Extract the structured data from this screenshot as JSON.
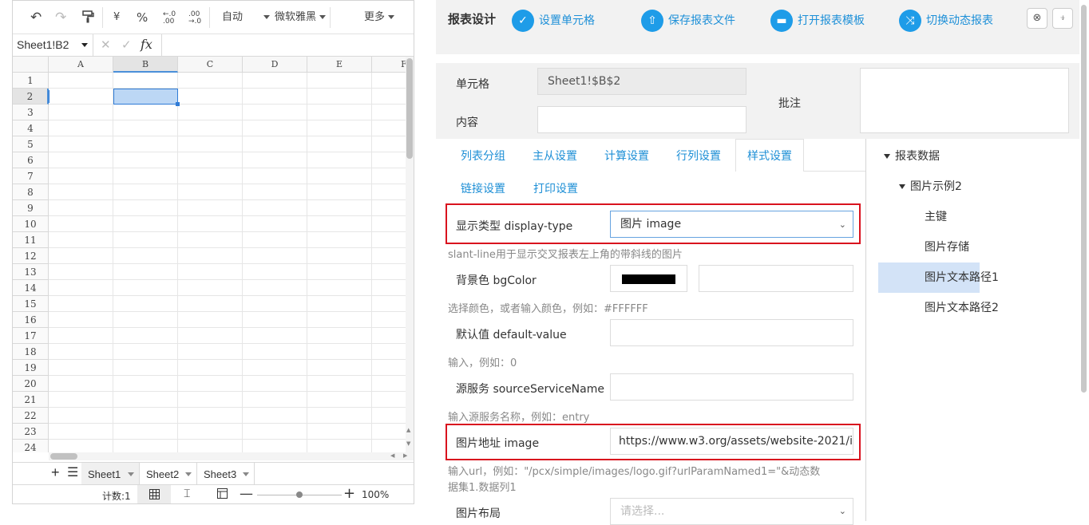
{
  "spreadsheet": {
    "toolbar": {
      "undo_icon": "undo-icon",
      "redo_icon": "redo-icon",
      "format_painter_icon": "format-painter-icon",
      "currency": "¥",
      "percent": "%",
      "dec_increase": ".0 .00",
      "dec_decrease": ".00 .0",
      "number_format": "自动",
      "font_name": "微软雅黑",
      "more": "更多"
    },
    "namebox": "Sheet1!B2",
    "formula_cancel": "✕",
    "formula_confirm": "✓",
    "formula_fx": "fx",
    "formula_value": "",
    "columns": [
      "A",
      "B",
      "C",
      "D",
      "E",
      "F"
    ],
    "rows": [
      "1",
      "2",
      "3",
      "4",
      "5",
      "6",
      "7",
      "8",
      "9",
      "10",
      "11",
      "12",
      "13",
      "14",
      "15",
      "16",
      "17",
      "18",
      "19",
      "20",
      "21",
      "22",
      "23",
      "24"
    ],
    "selected_cell": "B2",
    "sheets": [
      "Sheet1",
      "Sheet2",
      "Sheet3"
    ],
    "active_sheet": "Sheet1",
    "status": {
      "count_label": "计数:1",
      "zoom": "100%",
      "zoom_slider_value": 0.5
    }
  },
  "designer": {
    "title": "报表设计",
    "actions": [
      {
        "label": "设置单元格",
        "icon": "check-icon"
      },
      {
        "label": "保存报表文件",
        "icon": "upload-icon"
      },
      {
        "label": "打开报表模板",
        "icon": "folder-icon"
      },
      {
        "label": "切换动态报表",
        "icon": "shuffle-icon"
      }
    ],
    "close_icon": "close-circle-icon",
    "pin_icon": "pin-icon",
    "cell_label": "单元格",
    "cell_value": "Sheet1!$B$2",
    "content_label": "内容",
    "content_value": "",
    "comment_label": "批注",
    "comment_value": "",
    "tabs": [
      "列表分组",
      "主从设置",
      "计算设置",
      "行列设置",
      "样式设置",
      "链接设置",
      "打印设置"
    ],
    "active_tab": "样式设置",
    "fields": {
      "display_type_label": "显示类型 display-type",
      "display_type_value": "图片 image",
      "display_type_hint": "slant-line用于显示交叉报表左上角的带斜线的图片",
      "bgcolor_label": "背景色 bgColor",
      "bgcolor_swatch": "#000000",
      "bgcolor_text": "",
      "bgcolor_hint": "选择颜色，或者输入颜色，例如：#FFFFFF",
      "default_label": "默认值 default-value",
      "default_value": "",
      "default_hint": "输入，例如：0",
      "source_label": "源服务 sourceServiceName",
      "source_value": "",
      "source_hint": "输入源服务名称，例如：entry",
      "image_label": "图片地址 image",
      "image_value": "https://www.w3.org/assets/website-2021/i",
      "image_hint_line1": "输入url，例如：\"/pcx/simple/images/logo.gif?urlParamNamed1=\"&动态数",
      "image_hint_line2": "据集1.数据列1",
      "layout_label": "图片布局",
      "layout_placeholder": "请选择..."
    },
    "highlight_color": "#d9121e",
    "tree": {
      "root": "报表数据",
      "child": "图片示例2",
      "leaves": [
        "主键",
        "图片存储",
        "图片文本路径1",
        "图片文本路径2"
      ],
      "selected": "图片文本路径1"
    }
  }
}
